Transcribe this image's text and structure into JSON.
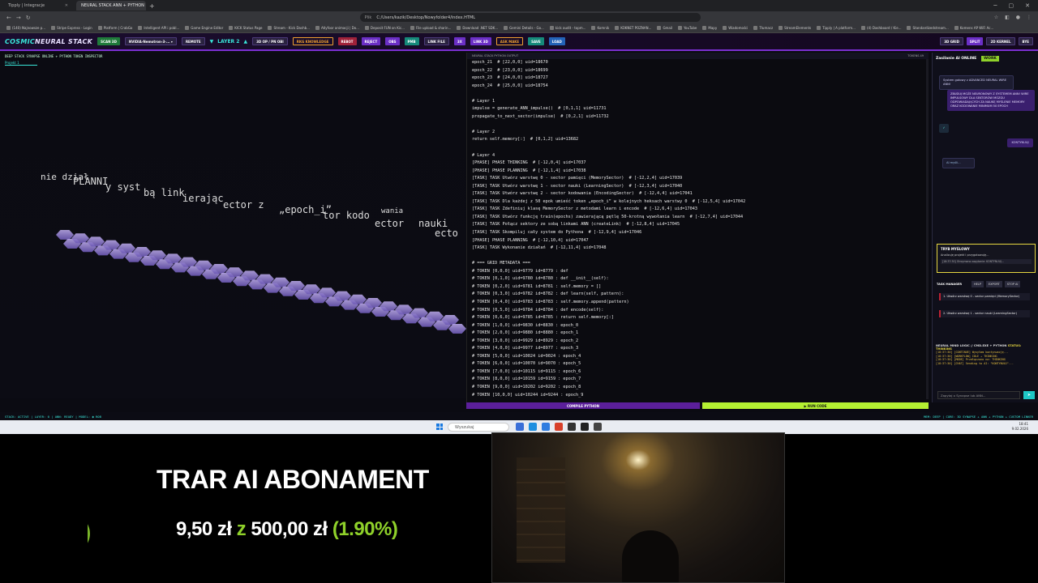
{
  "browser": {
    "tabs": [
      {
        "label": "Tipply | Integracje",
        "active": false
      },
      {
        "label": "NEURAL STACK ANN + PYTHON",
        "active": true
      }
    ],
    "file_label": "Plik",
    "url": "C:/Users/kazik/Desktop/Nowyfolder4/index.HTML",
    "bookmarks": [
      "(140) Najnowsze p...",
      "Stripe Express - Login",
      "Platform | CrabGo",
      "Intelligent API i pobl...",
      "Game Engine Editor",
      "KICK Status Page",
      "Stream - Kick Dashb...",
      "Atlyfoor animacji | Do...",
      "Deposit FUN on Kic...",
      "File upload & sharin...",
      "Download .NET SDK...",
      "Gemini Details - Go...",
      "kick audit - topm...",
      "Komnik",
      "KOKNET POZNAN...",
      "Gmail",
      "YouTube",
      "Mapy",
      "Wiadomości",
      "Tłumacz",
      "StreamElements",
      "Tipply | A platform...",
      "(4) Dashboard / Kie...",
      "Standardizedstream...",
      "Komens AP WiFi Ac..."
    ]
  },
  "app": {
    "logo_a": "COSMIC",
    "logo_b": "NEURAL STACK",
    "buttons": [
      "SCAN 3D",
      "NVIDIA-Nemotron-3-... ▾",
      "REMOTE",
      "3D OP / PN OBI",
      "RKG KNOWLEDGE",
      "REBOT",
      "REJECT",
      "OBS",
      "PMB",
      "LINK FILE",
      "3X",
      "LINK 3D",
      "ASK MAKE",
      "SAVE",
      "LOAD"
    ],
    "layer_label": "LAYER 2",
    "header_right": [
      "3D GRID",
      "SPLIT",
      "2D KERNEL",
      "BYE"
    ],
    "left_title": "DEEP STACK SYNAPSE ONLINE + PYTHON TOKEN INSPECTOR",
    "project_tab": "Projekt 1",
    "scene_words": [
      "nie dział",
      "PLANNI",
      "y syst",
      "bą link",
      "ierając",
      "ector z",
      "„epoch_i”",
      "tor kodo",
      "wania",
      "ector",
      "nauki",
      "ecto"
    ],
    "code_header_left": "NEURAL STACK PYTHON OUTPUT",
    "code_header_right": "TOKENS 49",
    "code_lines": [
      "epoch_21  # [22,0,0] uid=18670",
      "epoch_22  # [23,0,0] uid=18699",
      "epoch_23  # [24,0,0] uid=18727",
      "epoch_24  # [25,0,0] uid=18754",
      "",
      "# Layer 1",
      "impulse = generate_ANN_impulse()  # [0,1,1] uid=11731",
      "propagate_to_next_sector(impulse)  # [0,2,1] uid=11732",
      "",
      "# Layer 2",
      "return self.memory[:]  # [0,1,2] uid=13682",
      "",
      "# Layer 4",
      "[PHASE] PHASE THINKING  # [-12,0,4] uid=17037",
      "[PHASE] PHASE PLANNING  # [-12,1,4] uid=17038",
      "[TASK] TASK Utwórz warstwę 0 - sector pamięci (MemorySector)  # [-12,2,4] uid=17039",
      "[TASK] TASK Utwórz warstwę 1 - sector nauki (LearningSector)  # [-12,3,4] uid=17040",
      "[TASK] TASK Utwórz warstwę 2 - sector kodowania (EncodingSector)  # [-12,4,4] uid=17041",
      "[TASK] TASK Dla każdej z 50 epok umieść token „epoch_i” w kolejnych heksach warstwy 0  # [-12,5,4] uid=17042",
      "[TASK] TASK Zdefiniuj klasę MemorySector z metodami learn i encode  # [-12,6,4] uid=17043",
      "[TASK] TASK Utwórz funkcję train(epochs) zawierającą pętlę 50-krotną wywołania learn  # [-12,7,4] uid=17044",
      "[TASK] TASK Połącz sektory ze sobą linkami ANN (createLink)  # [-12,8,4] uid=17045",
      "[TASK] TASK Skompiluj cały system do Pythona  # [-12,9,4] uid=17046",
      "[PHASE] PHASE PLANNING  # [-12,10,4] uid=17047",
      "[TASK] TASK Wykonanie działań  # [-12,11,4] uid=17048",
      "",
      "# === GRID METADATA ===",
      "# TOKEN [0,0,0] uid=9779 id=8779 : def",
      "# TOKEN [0,1,0] uid=9780 id=8780 : def __init__(self):",
      "# TOKEN [0,2,0] uid=9781 id=8781 : self.memory = []",
      "# TOKEN [0,3,0] uid=9782 id=8782 : def learn(self, pattern):",
      "# TOKEN [0,4,0] uid=9783 id=8783 : self.memory.append(pattern)",
      "# TOKEN [0,5,0] uid=9784 id=8784 : def encode(self):",
      "# TOKEN [0,6,0] uid=9785 id=8785 : return self.memory[:]",
      "# TOKEN [1,0,0] uid=9830 id=8830 : epoch_0",
      "# TOKEN [2,0,0] uid=9880 id=8880 : epoch_1",
      "# TOKEN [3,0,0] uid=9929 id=8929 : epoch_2",
      "# TOKEN [4,0,0] uid=9977 id=8977 : epoch_3",
      "# TOKEN [5,0,0] uid=10024 id=9024 : epoch_4",
      "# TOKEN [6,0,0] uid=10070 id=9070 : epoch_5",
      "# TOKEN [7,0,0] uid=10115 id=9115 : epoch_6",
      "# TOKEN [8,0,0] uid=10159 id=9159 : epoch_7",
      "# TOKEN [9,0,0] uid=10202 id=9202 : epoch_8",
      "# TOKEN [10,0,0] uid=10244 id=9244 : epoch_9"
    ],
    "compile_label": "COMPILE PYTHON",
    "run_label": "▶ RUN CODE",
    "status_left": "STACK: ACTIVE | LAYER: 0 | ANN: READY | MODEL: ◉ ROB",
    "status_right": "MEM: DEEP | CORE: 3D SYNAPSE + ANN + PYTHON + CUSTOM LINKER"
  },
  "side": {
    "title": "Zasilanie AI ONLINE",
    "badge": "WORK",
    "system_msg": "System gotowy z ADVANCED NEURAL WIRE ANN!",
    "user_msg": "ZBUDUJ MOŻE NEURONOWY Z SYSTEMEM ANN! WIRE IMPULSOWY DLA SEKTORÓW MÓZGU ODPOWIADAJĄCYCH ZA NAUKĘ MYŚLENIE MEMORY ORAZ KODOWANIE MINIMUM 50 EPOCH",
    "check": "✓",
    "continue_msg": "KONTYNUUJ",
    "ai_working": "AI myśli...",
    "mode_title": "TRYB MYŚLOWY",
    "mode_sub": "Analizuję projekt i przygotowuję...",
    "mode_log": "[18:37:30] Otrzymano zapytanie: KONTYNUUJ...",
    "tasks_title": "TASK MANAGER",
    "tasks_buttons": [
      "HELP",
      "EXPORT",
      "STOP AI"
    ],
    "tasks": [
      "1. Utwórz warstwę 0 - sector pamięci (MemorySector)",
      "2. Utwórz warstwę 1 - sector nauki (LearningSector)"
    ],
    "log_title": "NEURAL MIND LOGIC // CMD.EXE + PYTHON",
    "log_status": "STATUS: THINKING",
    "log_lines": [
      "[18:37:30] [CONTINUE] Wysyłam kontynuację...",
      "[18:37:30] [WORKFLOW] IDLE → THINKING",
      "[18:37:30] [MODE] Przełączono na: THINKING",
      "[18:37:30] [CHAT] Sending to AI: \"KONTYNUUJ\"..."
    ],
    "input_placeholder": "Zapytaj o Synapse lub ANN...",
    "send": "➤"
  },
  "taskbar": {
    "search": "Wyszukaj",
    "time": "18:41",
    "date": "9.02.2026"
  },
  "overlay": {
    "title": "TRAR AI ABONAMENT",
    "amount_current": "9,50 zł",
    "amount_sep": "z",
    "amount_goal": "500,00 zł",
    "percent": "(1.90%)",
    "progress_fraction": 0.019
  },
  "colors": {
    "accent_cyan": "#39e6d9",
    "accent_purple": "#7a2fd0",
    "accent_lime": "#8fd12a"
  }
}
